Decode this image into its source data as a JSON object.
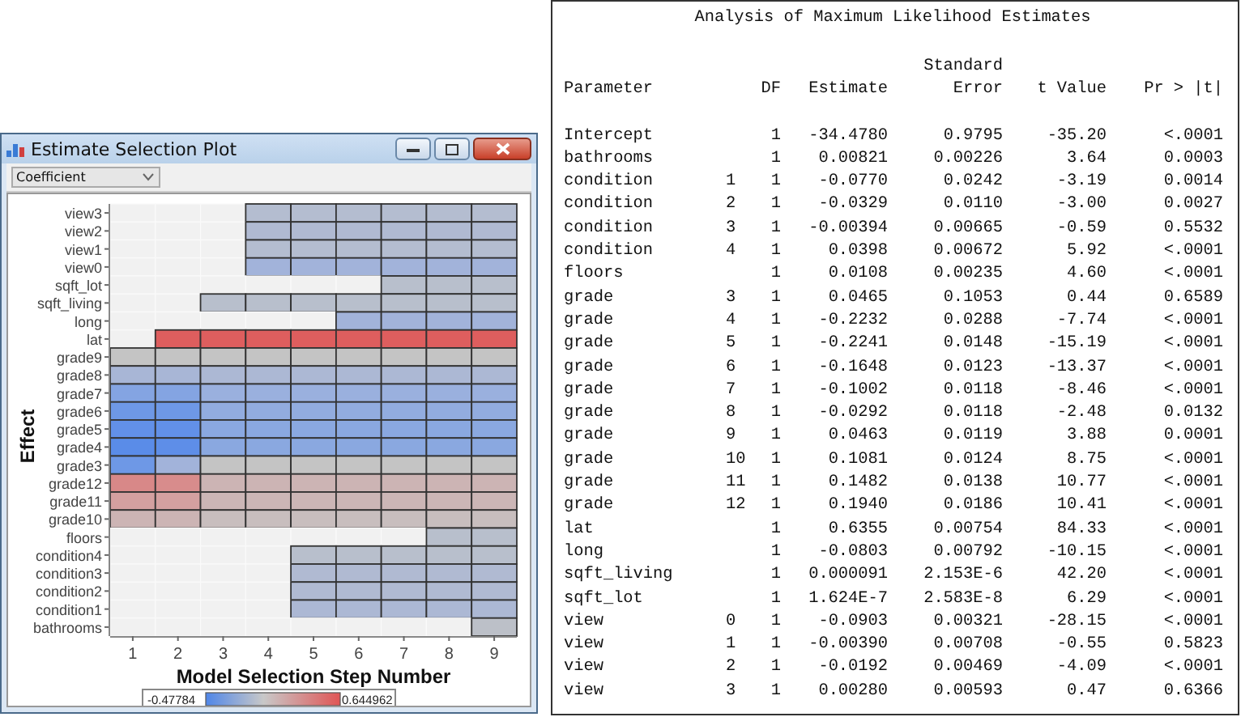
{
  "window": {
    "title": "Estimate Selection Plot"
  },
  "dropdown": {
    "value": "Coefficient"
  },
  "heatmap": {
    "ylabel": "Effect",
    "xlabel": "Model Selection Step Number",
    "x_ticks": [
      "1",
      "2",
      "3",
      "4",
      "5",
      "6",
      "7",
      "8",
      "9"
    ],
    "legend_min": "-0.47784",
    "legend_max": "0.644962",
    "rows": [
      {
        "label": "view3",
        "cells": [
          {
            "in_model": false
          },
          {
            "in_model": false
          },
          {
            "in_model": false
          },
          {
            "color": "#b4bdd0"
          },
          {
            "color": "#b4bdd0"
          },
          {
            "color": "#b4bdd0"
          },
          {
            "color": "#b4bdd0"
          },
          {
            "color": "#b4bdd0"
          },
          {
            "color": "#b4bdd0"
          }
        ]
      },
      {
        "label": "view2",
        "cells": [
          {
            "in_model": false
          },
          {
            "in_model": false
          },
          {
            "in_model": false
          },
          {
            "color": "#b0bad2"
          },
          {
            "color": "#b0bad2"
          },
          {
            "color": "#b0bad2"
          },
          {
            "color": "#b0bad2"
          },
          {
            "color": "#b0bad2"
          },
          {
            "color": "#b0bad2"
          }
        ]
      },
      {
        "label": "view1",
        "cells": [
          {
            "in_model": false
          },
          {
            "in_model": false
          },
          {
            "in_model": false
          },
          {
            "color": "#b4bdd0"
          },
          {
            "color": "#b4bdd0"
          },
          {
            "color": "#b4bdd0"
          },
          {
            "color": "#b4bdd0"
          },
          {
            "color": "#b4bdd0"
          },
          {
            "color": "#b4bdd0"
          }
        ]
      },
      {
        "label": "view0",
        "cells": [
          {
            "in_model": false
          },
          {
            "in_model": false
          },
          {
            "in_model": false
          },
          {
            "color": "#a2b3da"
          },
          {
            "color": "#a2b3da"
          },
          {
            "color": "#a2b3da"
          },
          {
            "color": "#a2b3da"
          },
          {
            "color": "#a2b3da"
          },
          {
            "color": "#a2b3da"
          }
        ]
      },
      {
        "label": "sqft_lot",
        "cells": [
          {
            "in_model": false
          },
          {
            "in_model": false
          },
          {
            "in_model": false
          },
          {
            "in_model": false
          },
          {
            "in_model": false
          },
          {
            "in_model": false
          },
          {
            "color": "#b8bfcc"
          },
          {
            "color": "#b8bfcc"
          },
          {
            "color": "#b8bfcc"
          }
        ]
      },
      {
        "label": "sqft_living",
        "cells": [
          {
            "in_model": false
          },
          {
            "in_model": false
          },
          {
            "color": "#b8bfcc"
          },
          {
            "color": "#b8bfcc"
          },
          {
            "color": "#b8bfcc"
          },
          {
            "color": "#b8bfcc"
          },
          {
            "color": "#b8bfcc"
          },
          {
            "color": "#b8bfcc"
          },
          {
            "color": "#b8bfcc"
          }
        ]
      },
      {
        "label": "long",
        "cells": [
          {
            "in_model": false
          },
          {
            "in_model": false
          },
          {
            "in_model": false
          },
          {
            "in_model": false
          },
          {
            "in_model": false
          },
          {
            "color": "#a2b3da"
          },
          {
            "color": "#a2b3da"
          },
          {
            "color": "#a2b3da"
          },
          {
            "color": "#a2b3da"
          }
        ]
      },
      {
        "label": "lat",
        "cells": [
          {
            "in_model": false
          },
          {
            "color": "#de5e5e"
          },
          {
            "color": "#de5e5e"
          },
          {
            "color": "#de5e5e"
          },
          {
            "color": "#de5e5e"
          },
          {
            "color": "#de5e5e"
          },
          {
            "color": "#de5e5e"
          },
          {
            "color": "#de5e5e"
          },
          {
            "color": "#de5e5e"
          }
        ]
      },
      {
        "label": "grade9",
        "cells": [
          {
            "color": "#c4c4c4"
          },
          {
            "color": "#c4c4c4"
          },
          {
            "color": "#c4c4c4"
          },
          {
            "color": "#c4c4c4"
          },
          {
            "color": "#c4c4c4"
          },
          {
            "color": "#c4c4c4"
          },
          {
            "color": "#c4c4c4"
          },
          {
            "color": "#c4c4c4"
          },
          {
            "color": "#c4c4c4"
          }
        ]
      },
      {
        "label": "grade8",
        "cells": [
          {
            "color": "#a8b6d6"
          },
          {
            "color": "#a8b6d6"
          },
          {
            "color": "#acb8d4"
          },
          {
            "color": "#acb8d4"
          },
          {
            "color": "#acb8d4"
          },
          {
            "color": "#acb8d4"
          },
          {
            "color": "#acb8d4"
          },
          {
            "color": "#acb8d4"
          },
          {
            "color": "#acb8d4"
          }
        ]
      },
      {
        "label": "grade7",
        "cells": [
          {
            "color": "#84a4e2"
          },
          {
            "color": "#84a4e2"
          },
          {
            "color": "#9ab0de"
          },
          {
            "color": "#9ab0de"
          },
          {
            "color": "#9ab0de"
          },
          {
            "color": "#9ab0de"
          },
          {
            "color": "#9ab0de"
          },
          {
            "color": "#9ab0de"
          },
          {
            "color": "#9ab0de"
          }
        ]
      },
      {
        "label": "grade6",
        "cells": [
          {
            "color": "#6e98e6"
          },
          {
            "color": "#6e98e6"
          },
          {
            "color": "#92acdf"
          },
          {
            "color": "#92acdf"
          },
          {
            "color": "#92acdf"
          },
          {
            "color": "#92acdf"
          },
          {
            "color": "#92acdf"
          },
          {
            "color": "#92acdf"
          },
          {
            "color": "#92acdf"
          }
        ]
      },
      {
        "label": "grade5",
        "cells": [
          {
            "color": "#6290e8"
          },
          {
            "color": "#6290e8"
          },
          {
            "color": "#8aa8e0"
          },
          {
            "color": "#8aa8e0"
          },
          {
            "color": "#8aa8e0"
          },
          {
            "color": "#8aa8e0"
          },
          {
            "color": "#8aa8e0"
          },
          {
            "color": "#8aa8e0"
          },
          {
            "color": "#8aa8e0"
          }
        ]
      },
      {
        "label": "grade4",
        "cells": [
          {
            "color": "#5a8ce8"
          },
          {
            "color": "#5e8ee8"
          },
          {
            "color": "#8aa8e0"
          },
          {
            "color": "#8aa8e0"
          },
          {
            "color": "#8aa8e0"
          },
          {
            "color": "#8aa8e0"
          },
          {
            "color": "#8aa8e0"
          },
          {
            "color": "#8aa8e0"
          },
          {
            "color": "#8aa8e0"
          }
        ]
      },
      {
        "label": "grade3",
        "cells": [
          {
            "color": "#6e98e6"
          },
          {
            "color": "#a2b3da"
          },
          {
            "color": "#c4c4c4"
          },
          {
            "color": "#c4c4c4"
          },
          {
            "color": "#c4c4c4"
          },
          {
            "color": "#c4c4c4"
          },
          {
            "color": "#c4c4c4"
          },
          {
            "color": "#c4c4c4"
          },
          {
            "color": "#c4c4c4"
          }
        ]
      },
      {
        "label": "grade12",
        "cells": [
          {
            "color": "#d88888"
          },
          {
            "color": "#d88c8c"
          },
          {
            "color": "#ccb4b4"
          },
          {
            "color": "#ccb4b4"
          },
          {
            "color": "#ccb4b4"
          },
          {
            "color": "#ccb4b4"
          },
          {
            "color": "#ccb4b4"
          },
          {
            "color": "#ccb4b4"
          },
          {
            "color": "#ccb4b4"
          }
        ]
      },
      {
        "label": "grade11",
        "cells": [
          {
            "color": "#d4a0a0"
          },
          {
            "color": "#d4a0a0"
          },
          {
            "color": "#ccb6b6"
          },
          {
            "color": "#ccb6b6"
          },
          {
            "color": "#ccb6b6"
          },
          {
            "color": "#ccb6b6"
          },
          {
            "color": "#ccb6b6"
          },
          {
            "color": "#ccb6b6"
          },
          {
            "color": "#ccb6b6"
          }
        ]
      },
      {
        "label": "grade10",
        "cells": [
          {
            "color": "#ccb4b4"
          },
          {
            "color": "#ccb4b4"
          },
          {
            "color": "#c8bebe"
          },
          {
            "color": "#c8bebe"
          },
          {
            "color": "#c8bebe"
          },
          {
            "color": "#c8bebe"
          },
          {
            "color": "#c8bebe"
          },
          {
            "color": "#c8bebe"
          },
          {
            "color": "#c8bebe"
          }
        ]
      },
      {
        "label": "floors",
        "cells": [
          {
            "in_model": false
          },
          {
            "in_model": false
          },
          {
            "in_model": false
          },
          {
            "in_model": false
          },
          {
            "in_model": false
          },
          {
            "in_model": false
          },
          {
            "in_model": false
          },
          {
            "color": "#b8bfcc"
          },
          {
            "color": "#b8bfcc"
          }
        ]
      },
      {
        "label": "condition4",
        "cells": [
          {
            "in_model": false
          },
          {
            "in_model": false
          },
          {
            "in_model": false
          },
          {
            "in_model": false
          },
          {
            "color": "#b8bfcc"
          },
          {
            "color": "#b8bfcc"
          },
          {
            "color": "#b8bfcc"
          },
          {
            "color": "#b8bfcc"
          },
          {
            "color": "#b8bfcc"
          }
        ]
      },
      {
        "label": "condition3",
        "cells": [
          {
            "in_model": false
          },
          {
            "in_model": false
          },
          {
            "in_model": false
          },
          {
            "in_model": false
          },
          {
            "color": "#b0bad2"
          },
          {
            "color": "#b0bad2"
          },
          {
            "color": "#b0bad2"
          },
          {
            "color": "#b0bad2"
          },
          {
            "color": "#b0bad2"
          }
        ]
      },
      {
        "label": "condition2",
        "cells": [
          {
            "in_model": false
          },
          {
            "in_model": false
          },
          {
            "in_model": false
          },
          {
            "in_model": false
          },
          {
            "color": "#b0bad2"
          },
          {
            "color": "#b0bad2"
          },
          {
            "color": "#b0bad2"
          },
          {
            "color": "#b0bad2"
          },
          {
            "color": "#b0bad2"
          }
        ]
      },
      {
        "label": "condition1",
        "cells": [
          {
            "in_model": false
          },
          {
            "in_model": false
          },
          {
            "in_model": false
          },
          {
            "in_model": false
          },
          {
            "color": "#acb8d4"
          },
          {
            "color": "#acb8d4"
          },
          {
            "color": "#acb8d4"
          },
          {
            "color": "#acb8d4"
          },
          {
            "color": "#acb8d4"
          }
        ]
      },
      {
        "label": "bathrooms",
        "cells": [
          {
            "in_model": false
          },
          {
            "in_model": false
          },
          {
            "in_model": false
          },
          {
            "in_model": false
          },
          {
            "in_model": false
          },
          {
            "in_model": false
          },
          {
            "in_model": false
          },
          {
            "in_model": false
          },
          {
            "color": "#bcc0c8"
          }
        ]
      }
    ]
  },
  "table": {
    "title": "Analysis of Maximum Likelihood Estimates",
    "columns": [
      {
        "lines": [
          "Parameter"
        ]
      },
      {
        "lines": [
          "DF"
        ]
      },
      {
        "lines": [
          "Estimate"
        ]
      },
      {
        "lines": [
          "Standard",
          "Error"
        ]
      },
      {
        "lines": [
          "t Value"
        ]
      },
      {
        "lines": [
          "Pr > |t|"
        ]
      }
    ],
    "rows": [
      {
        "parameter": "Intercept",
        "df": "1",
        "estimate": "-34.4780",
        "std_error": "0.9795",
        "t_value": "-35.20",
        "p": "<.0001"
      },
      {
        "parameter": "bathrooms",
        "df": "1",
        "estimate": "0.00821",
        "std_error": "0.00226",
        "t_value": "3.64",
        "p": "0.0003"
      },
      {
        "parameter": "condition",
        "class": "1",
        "df": "1",
        "estimate": "-0.0770",
        "std_error": "0.0242",
        "t_value": "-3.19",
        "p": "0.0014"
      },
      {
        "parameter": "condition",
        "class": "2",
        "df": "1",
        "estimate": "-0.0329",
        "std_error": "0.0110",
        "t_value": "-3.00",
        "p": "0.0027"
      },
      {
        "parameter": "condition",
        "class": "3",
        "df": "1",
        "estimate": "-0.00394",
        "std_error": "0.00665",
        "t_value": "-0.59",
        "p": "0.5532"
      },
      {
        "parameter": "condition",
        "class": "4",
        "df": "1",
        "estimate": "0.0398",
        "std_error": "0.00672",
        "t_value": "5.92",
        "p": "<.0001"
      },
      {
        "parameter": "floors",
        "df": "1",
        "estimate": "0.0108",
        "std_error": "0.00235",
        "t_value": "4.60",
        "p": "<.0001"
      },
      {
        "parameter": "grade",
        "class": "3",
        "df": "1",
        "estimate": "0.0465",
        "std_error": "0.1053",
        "t_value": "0.44",
        "p": "0.6589"
      },
      {
        "parameter": "grade",
        "class": "4",
        "df": "1",
        "estimate": "-0.2232",
        "std_error": "0.0288",
        "t_value": "-7.74",
        "p": "<.0001"
      },
      {
        "parameter": "grade",
        "class": "5",
        "df": "1",
        "estimate": "-0.2241",
        "std_error": "0.0148",
        "t_value": "-15.19",
        "p": "<.0001"
      },
      {
        "parameter": "grade",
        "class": "6",
        "df": "1",
        "estimate": "-0.1648",
        "std_error": "0.0123",
        "t_value": "-13.37",
        "p": "<.0001"
      },
      {
        "parameter": "grade",
        "class": "7",
        "df": "1",
        "estimate": "-0.1002",
        "std_error": "0.0118",
        "t_value": "-8.46",
        "p": "<.0001"
      },
      {
        "parameter": "grade",
        "class": "8",
        "df": "1",
        "estimate": "-0.0292",
        "std_error": "0.0118",
        "t_value": "-2.48",
        "p": "0.0132"
      },
      {
        "parameter": "grade",
        "class": "9",
        "df": "1",
        "estimate": "0.0463",
        "std_error": "0.0119",
        "t_value": "3.88",
        "p": "0.0001"
      },
      {
        "parameter": "grade",
        "class": "10",
        "df": "1",
        "estimate": "0.1081",
        "std_error": "0.0124",
        "t_value": "8.75",
        "p": "<.0001"
      },
      {
        "parameter": "grade",
        "class": "11",
        "df": "1",
        "estimate": "0.1482",
        "std_error": "0.0138",
        "t_value": "10.77",
        "p": "<.0001"
      },
      {
        "parameter": "grade",
        "class": "12",
        "df": "1",
        "estimate": "0.1940",
        "std_error": "0.0186",
        "t_value": "10.41",
        "p": "<.0001"
      },
      {
        "parameter": "lat",
        "df": "1",
        "estimate": "0.6355",
        "std_error": "0.00754",
        "t_value": "84.33",
        "p": "<.0001"
      },
      {
        "parameter": "long",
        "df": "1",
        "estimate": "-0.0803",
        "std_error": "0.00792",
        "t_value": "-10.15",
        "p": "<.0001"
      },
      {
        "parameter": "sqft_living",
        "df": "1",
        "estimate": "0.000091",
        "std_error": "2.153E-6",
        "t_value": "42.20",
        "p": "<.0001"
      },
      {
        "parameter": "sqft_lot",
        "df": "1",
        "estimate": "1.624E-7",
        "std_error": "2.583E-8",
        "t_value": "6.29",
        "p": "<.0001"
      },
      {
        "parameter": "view",
        "class": "0",
        "df": "1",
        "estimate": "-0.0903",
        "std_error": "0.00321",
        "t_value": "-28.15",
        "p": "<.0001"
      },
      {
        "parameter": "view",
        "class": "1",
        "df": "1",
        "estimate": "-0.00390",
        "std_error": "0.00708",
        "t_value": "-0.55",
        "p": "0.5823"
      },
      {
        "parameter": "view",
        "class": "2",
        "df": "1",
        "estimate": "-0.0192",
        "std_error": "0.00469",
        "t_value": "-4.09",
        "p": "<.0001"
      },
      {
        "parameter": "view",
        "class": "3",
        "df": "1",
        "estimate": "0.00280",
        "std_error": "0.00593",
        "t_value": "0.47",
        "p": "0.6366"
      }
    ]
  }
}
